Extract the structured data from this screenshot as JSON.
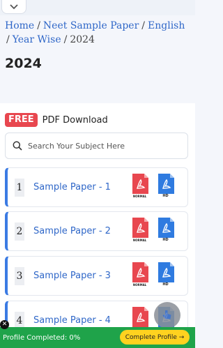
{
  "breadcrumb": {
    "items": [
      "Home",
      "Neet Sample Paper",
      "English",
      "Year Wise",
      "2024"
    ],
    "separator": "/"
  },
  "page_title": "2024",
  "pdf_section": {
    "badge": "FREE",
    "label": "PDF Download"
  },
  "search": {
    "placeholder": "Search Your Subject Here"
  },
  "papers": [
    {
      "num": "1",
      "title": "Sample Paper - 1"
    },
    {
      "num": "2",
      "title": "Sample Paper - 2"
    },
    {
      "num": "3",
      "title": "Sample Paper - 3"
    },
    {
      "num": "4",
      "title": "Sample Paper - 4"
    }
  ],
  "file_icons": {
    "normal_label": "NORMAL",
    "hd_label": "HD"
  },
  "bottom_bar": {
    "text": "Profile Completed: 0%",
    "button": "Complete Profile →"
  },
  "colors": {
    "accent_blue": "#2f67c8",
    "card_border": "#3b7be3",
    "free_red": "#e8474f",
    "bar_green": "#1fa34a",
    "cta_yellow": "#ffd21f",
    "pdf_red": "#e8474f",
    "hd_blue": "#2f7be0"
  },
  "icons": [
    "chevron-down-icon",
    "search-icon",
    "pdf-normal-icon",
    "pdf-hd-icon",
    "close-icon"
  ]
}
